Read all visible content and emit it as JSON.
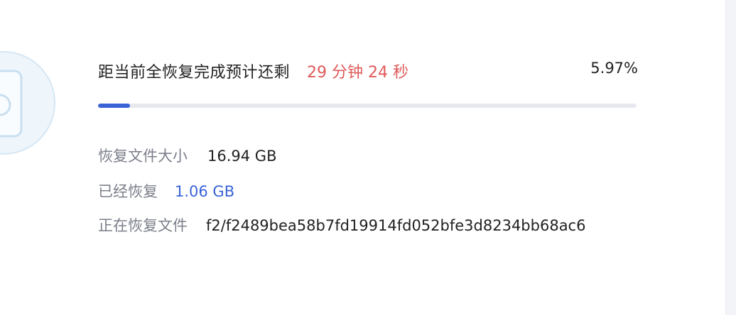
{
  "restore": {
    "eta_label": "距当前全恢复完成预计还剩",
    "eta_time": "29 分钟 24 秒",
    "percent": "5.97%",
    "progress": 0.0597
  },
  "stats": {
    "size_label": "恢复文件大小",
    "size_value": "16.94 GB",
    "restored_label": "已经恢复",
    "restored_value": "1.06 GB",
    "current_label": "正在恢复文件",
    "current_value": "f2/f2489bea58b7fd19914fd052bfe3d8234bb68ac6"
  },
  "colors": {
    "accent": "#3a63d8",
    "time": "#e05a5a",
    "track": "#e7e9ef"
  },
  "icons": {
    "hero": "restore-drive-icon"
  }
}
